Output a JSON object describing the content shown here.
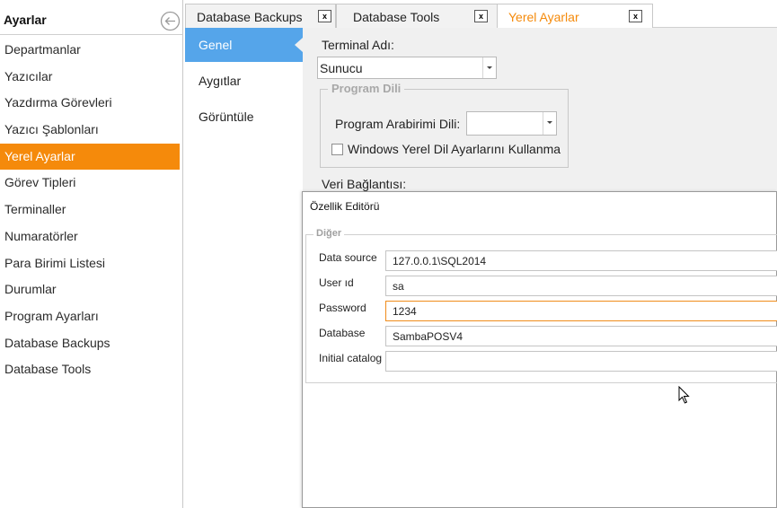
{
  "sidebar": {
    "title": "Ayarlar",
    "back_icon": "circle-arrow-left-icon",
    "items": [
      {
        "label": "Departmanlar"
      },
      {
        "label": "Yazıcılar"
      },
      {
        "label": "Yazdırma Görevleri"
      },
      {
        "label": "Yazıcı Şablonları"
      },
      {
        "label": "Yerel Ayarlar",
        "active": true
      },
      {
        "label": "Görev Tipleri"
      },
      {
        "label": "Terminaller"
      },
      {
        "label": "Numaratörler"
      },
      {
        "label": "Para Birimi Listesi"
      },
      {
        "label": "Durumlar"
      },
      {
        "label": "Program Ayarları"
      },
      {
        "label": "Database Backups"
      },
      {
        "label": "Database Tools"
      }
    ]
  },
  "tabs": [
    {
      "label": "Database Backups",
      "close": "x"
    },
    {
      "label": "Database Tools",
      "close": "x"
    },
    {
      "label": "Yerel Ayarlar",
      "close": "x",
      "active": true
    }
  ],
  "inner_nav": {
    "items": [
      {
        "label": "Genel",
        "active": true
      },
      {
        "label": "Aygıtlar"
      },
      {
        "label": "Görüntüle"
      }
    ]
  },
  "settings": {
    "terminal_label": "Terminal Adı:",
    "terminal_value": "Sunucu",
    "program_dili_legend": "Program Dili",
    "arabirim_label": "Program Arabirimi Dili:",
    "arabirim_value": "",
    "windows_locale_label": "Windows Yerel Dil Ayarlarını Kullanma",
    "windows_locale_checked": false,
    "veri_label": "Veri Bağlantısı:"
  },
  "editor": {
    "title": "Özellik Editörü",
    "group_legend": "Diğer",
    "fields": [
      {
        "label": "Data source",
        "value": "127.0.0.1\\SQL2014"
      },
      {
        "label": "User ıd",
        "value": "sa"
      },
      {
        "label": "Password",
        "value": "1234",
        "focused": true
      },
      {
        "label": "Database",
        "value": "SambaPOSV4"
      },
      {
        "label": "Initial catalog",
        "value": ""
      }
    ]
  },
  "colors": {
    "accent_orange": "#f58a0b",
    "nav_blue": "#55a5ea",
    "panel_gray": "#f0f0f0",
    "focus_border": "#f08c1a"
  },
  "icons": {
    "cursor": "mouse-pointer-icon",
    "dropdown": "chevron-down-icon"
  }
}
